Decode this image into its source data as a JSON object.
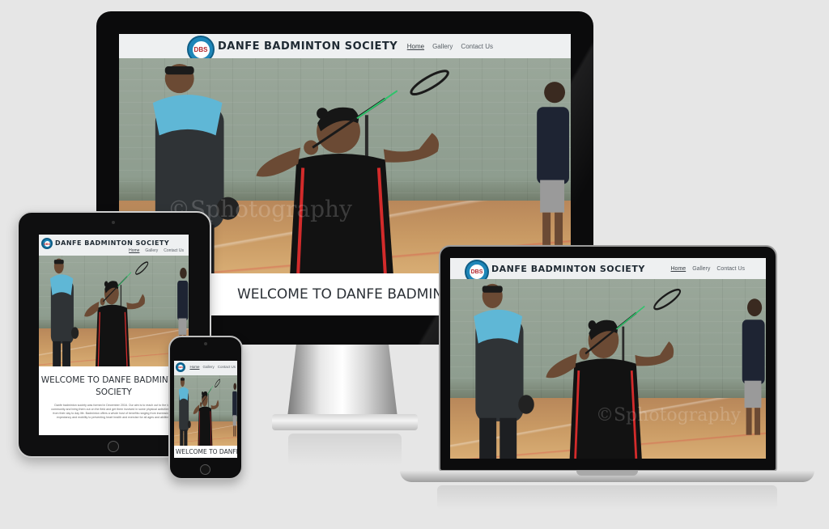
{
  "site": {
    "brand": "DANFE BADMINTON SOCIETY",
    "logo_text": "DBS",
    "nav": {
      "home": "Home",
      "gallery": "Gallery",
      "contact": "Contact Us"
    },
    "welcome_title": "WELCOME TO DANFE BADMINTON SOCIETY",
    "welcome_title_tablet_line1": "WELCOME TO DANFE BADMINTON",
    "welcome_title_tablet_line2": "SOCIETY",
    "welcome_title_phone": "WELCOME TO DANFE",
    "intro_text": "Danfe badminton society was formed in December 2016. Our aim is to reach out to the local community and bring them out on the field and get them involved in some physical activities apart from their day to day life. Badminton offers a whole host of benefits ranging from increasing life expectancy and mobility to preventing heart health and exercise for all ages and abilities.",
    "watermark": "©Sphotography"
  },
  "colors": {
    "background": "#e6e6e6",
    "nav_bg": "#eef0f1",
    "logo_blue": "#1e86b8",
    "text_dark": "#2b3036"
  }
}
